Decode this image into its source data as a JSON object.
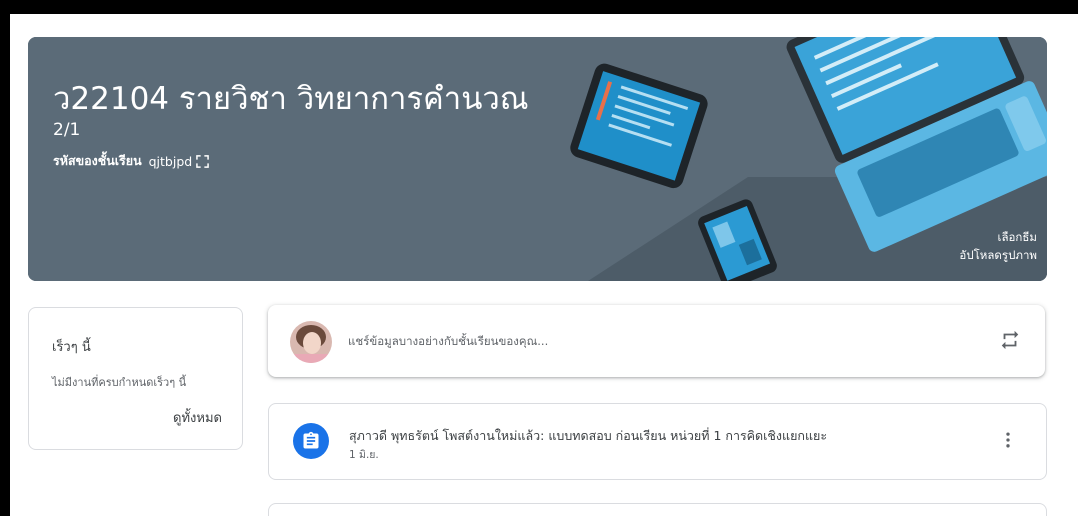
{
  "banner": {
    "title": "ว22104 รายวิชา วิทยาการคำนวณ",
    "section": "2/1",
    "class_code_label": "รหัสของชั้นเรียน",
    "class_code": "qjtbjpd",
    "select_theme_label": "เลือกธีม",
    "upload_photo_label": "อัปโหลดรูปภาพ",
    "background_color": "#5b6b78"
  },
  "upcoming": {
    "title": "เร็วๆ นี้",
    "empty_text": "ไม่มีงานที่ครบกำหนดเร็วๆ นี้",
    "view_all_label": "ดูทั้งหมด"
  },
  "share": {
    "placeholder": "แชร์ข้อมูลบางอย่างกับชั้นเรียนของคุณ..."
  },
  "stream": {
    "posts": [
      {
        "title": "สุภาวดี พุทธรัตน์ โพสต์งานใหม่แล้ว: แบบทดสอบ ก่อนเรียน หน่วยที่ 1 การคิดเชิงแยกแยะ",
        "date": "1 มิ.ย.",
        "icon": "assignment-icon",
        "icon_color": "#1a73e8"
      }
    ]
  }
}
